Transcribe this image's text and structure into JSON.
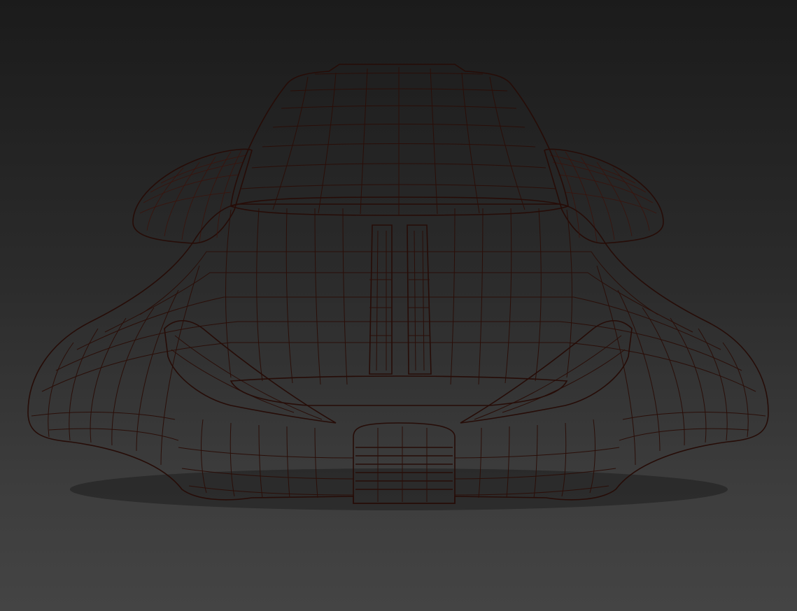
{
  "viewport": {
    "background_top": "#1b1b1b",
    "background_bottom": "#444444"
  },
  "model": {
    "color": "#c8503f",
    "shade_color": "#9a3426",
    "highlight_color": "#e07a68",
    "wire_color": "#2a0e08"
  }
}
